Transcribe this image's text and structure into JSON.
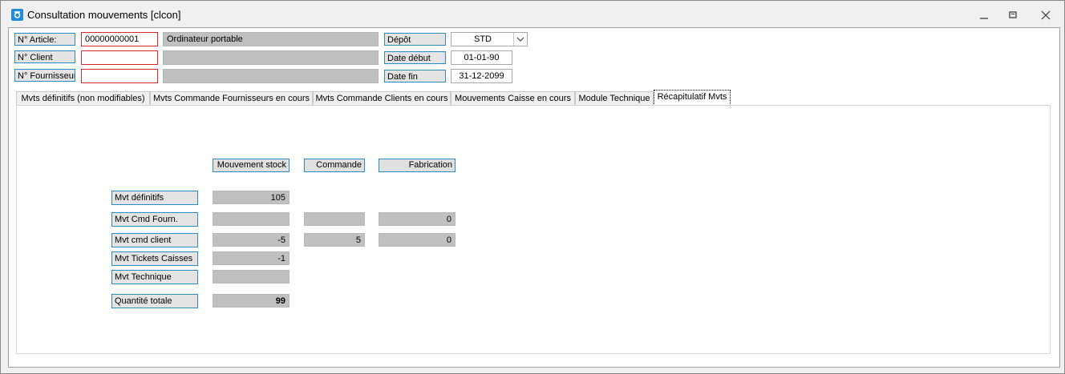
{
  "window": {
    "title": "Consultation mouvements [clcon]",
    "icon": "app-icon",
    "accent_color": "#2a8bc8",
    "required_border_color": "#d42a2a"
  },
  "header": {
    "article_label": "N° Article:",
    "article_value": "00000000001",
    "article_name": "Ordinateur portable",
    "client_label": "N° Client",
    "client_value": "",
    "client_name": "",
    "supplier_label": "N° Fournisseur",
    "supplier_value": "",
    "supplier_name": "",
    "depot_label": "Dépôt",
    "depot_value": "STD",
    "date_start_label": "Date début",
    "date_start_value": "01-01-90",
    "date_end_label": "Date fin",
    "date_end_value": "31-12-2099"
  },
  "tabs": [
    {
      "label": "Mvts définitifs (non modifiables)",
      "active": false
    },
    {
      "label": "Mvts Commande Fournisseurs en cours",
      "active": false
    },
    {
      "label": "Mvts Commande Clients en cours",
      "active": false
    },
    {
      "label": "Mouvements Caisse en cours",
      "active": false
    },
    {
      "label": "Module Technique",
      "active": false
    },
    {
      "label": "Récapitulatif Mvts",
      "active": true
    }
  ],
  "recap": {
    "columns": [
      "Mouvement stock",
      "Commande",
      "Fabrication"
    ],
    "rows": [
      {
        "label": "Mvt définitifs",
        "stock": "105"
      },
      {
        "label": "Mvt Cmd Fourn.",
        "stock": "",
        "commande": "",
        "fabrication": "0"
      },
      {
        "label": "Mvt cmd client",
        "stock": "-5",
        "commande": "5",
        "fabrication": "0"
      },
      {
        "label": "Mvt Tickets Caisses",
        "stock": "-1"
      },
      {
        "label": "Mvt Technique",
        "stock": ""
      },
      {
        "label": "Quantité totale",
        "stock": "99"
      }
    ]
  }
}
